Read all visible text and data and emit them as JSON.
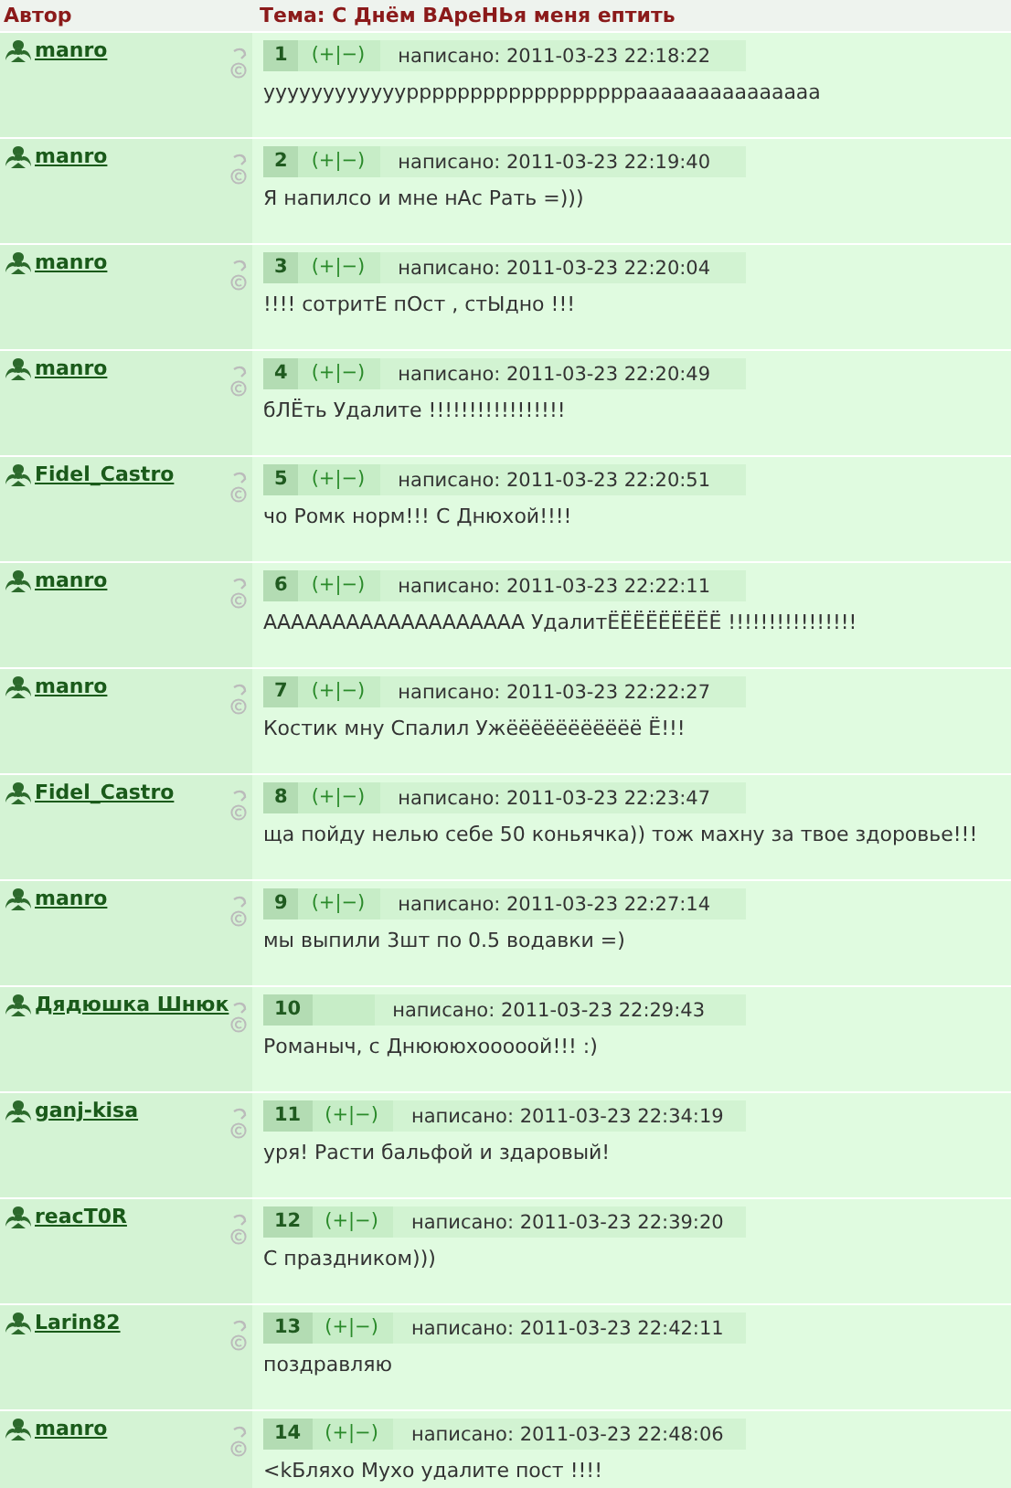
{
  "header": {
    "author_label": "Автор",
    "topic": "Тема: С Днём ВАреНЬя меня ептить"
  },
  "posts": [
    {
      "author": "manro",
      "number": "1",
      "votes": "(+|−)",
      "date": "написано: 2011-03-23 22:18:22",
      "text": "ууууууууууууррррррррррррррррррааааааааааааааа"
    },
    {
      "author": "manro",
      "number": "2",
      "votes": "(+|−)",
      "date": "написано: 2011-03-23 22:19:40",
      "text": "Я напилсо и мне нАс Рать =)))"
    },
    {
      "author": "manro",
      "number": "3",
      "votes": "(+|−)",
      "date": "написано: 2011-03-23 22:20:04",
      "text": "!!!! сотритЕ пОст , стЫдно !!!"
    },
    {
      "author": "manro",
      "number": "4",
      "votes": "(+|−)",
      "date": "написано: 2011-03-23 22:20:49",
      "text": "бЛЁть Удалите !!!!!!!!!!!!!!!!!"
    },
    {
      "author": "Fidel_Castro",
      "number": "5",
      "votes": "(+|−)",
      "date": "написано: 2011-03-23 22:20:51",
      "text": "чо Ромк норм!!! С Днюхой!!!!"
    },
    {
      "author": "manro",
      "number": "6",
      "votes": "(+|−)",
      "date": "написано: 2011-03-23 22:22:11",
      "text": "ААААААААААААААААААА УдалитЁЁЁЁЁЁЁЁЁ !!!!!!!!!!!!!!!!"
    },
    {
      "author": "manro",
      "number": "7",
      "votes": "(+|−)",
      "date": "написано: 2011-03-23 22:22:27",
      "text": "Костик мну Спалил Ужёёёёёёёёёёё Ё!!!"
    },
    {
      "author": "Fidel_Castro",
      "number": "8",
      "votes": "(+|−)",
      "date": "написано: 2011-03-23 22:23:47",
      "text": "ща пойду нелью себе 50 коньячка)) тож махну за твое здоровье!!!"
    },
    {
      "author": "manro",
      "number": "9",
      "votes": "(+|−)",
      "date": "написано: 2011-03-23 22:27:14",
      "text": "мы выпили 3шт по 0.5 водавки =)"
    },
    {
      "author": "Дядюшка Шнюк",
      "number": "10",
      "date": "написано: 2011-03-23 22:29:43",
      "text": "Романыч, с Днюююхооооой!!! :)"
    },
    {
      "author": "ganj-kisa",
      "number": "11",
      "votes": "(+|−)",
      "date": "написано: 2011-03-23 22:34:19",
      "text": "уря! Расти бальфой и здаровый!"
    },
    {
      "author": "reacT0R",
      "number": "12",
      "votes": "(+|−)",
      "date": "написано: 2011-03-23 22:39:20",
      "text": "С праздником)))"
    },
    {
      "author": "Larin82",
      "number": "13",
      "votes": "(+|−)",
      "date": "написано: 2011-03-23 22:42:11",
      "text": "поздравляю"
    },
    {
      "author": "manro",
      "number": "14",
      "votes": "(+|−)",
      "date": "написано: 2011-03-23 22:48:06",
      "text": "<kБляхо Мухо удалите пост !!!!"
    }
  ]
}
